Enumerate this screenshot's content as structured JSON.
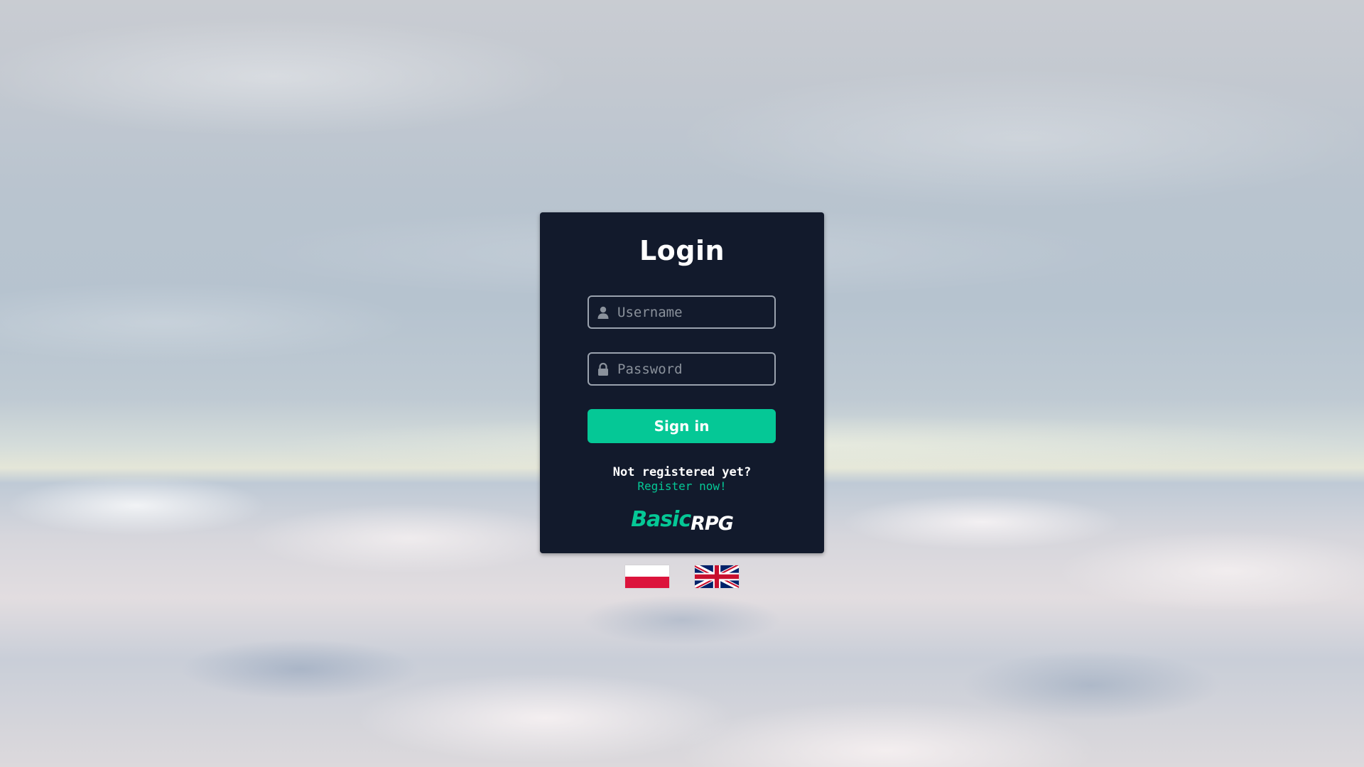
{
  "login": {
    "title": "Login",
    "username_placeholder": "Username",
    "password_placeholder": "Password",
    "username_value": "",
    "password_value": "",
    "signin_label": "Sign in",
    "not_registered_text": "Not registered yet?",
    "register_link_text": "Register now!"
  },
  "brand": {
    "part1": "Basic",
    "part2": "RPG"
  },
  "icons": {
    "username": "user-icon",
    "password": "lock-icon"
  },
  "languages": [
    {
      "code": "pl",
      "flag": "poland-flag"
    },
    {
      "code": "en",
      "flag": "uk-flag"
    }
  ],
  "colors": {
    "card_bg": "#121a2c",
    "accent": "#05c896",
    "text": "#ffffff",
    "field_border": "#9aa2ae"
  }
}
